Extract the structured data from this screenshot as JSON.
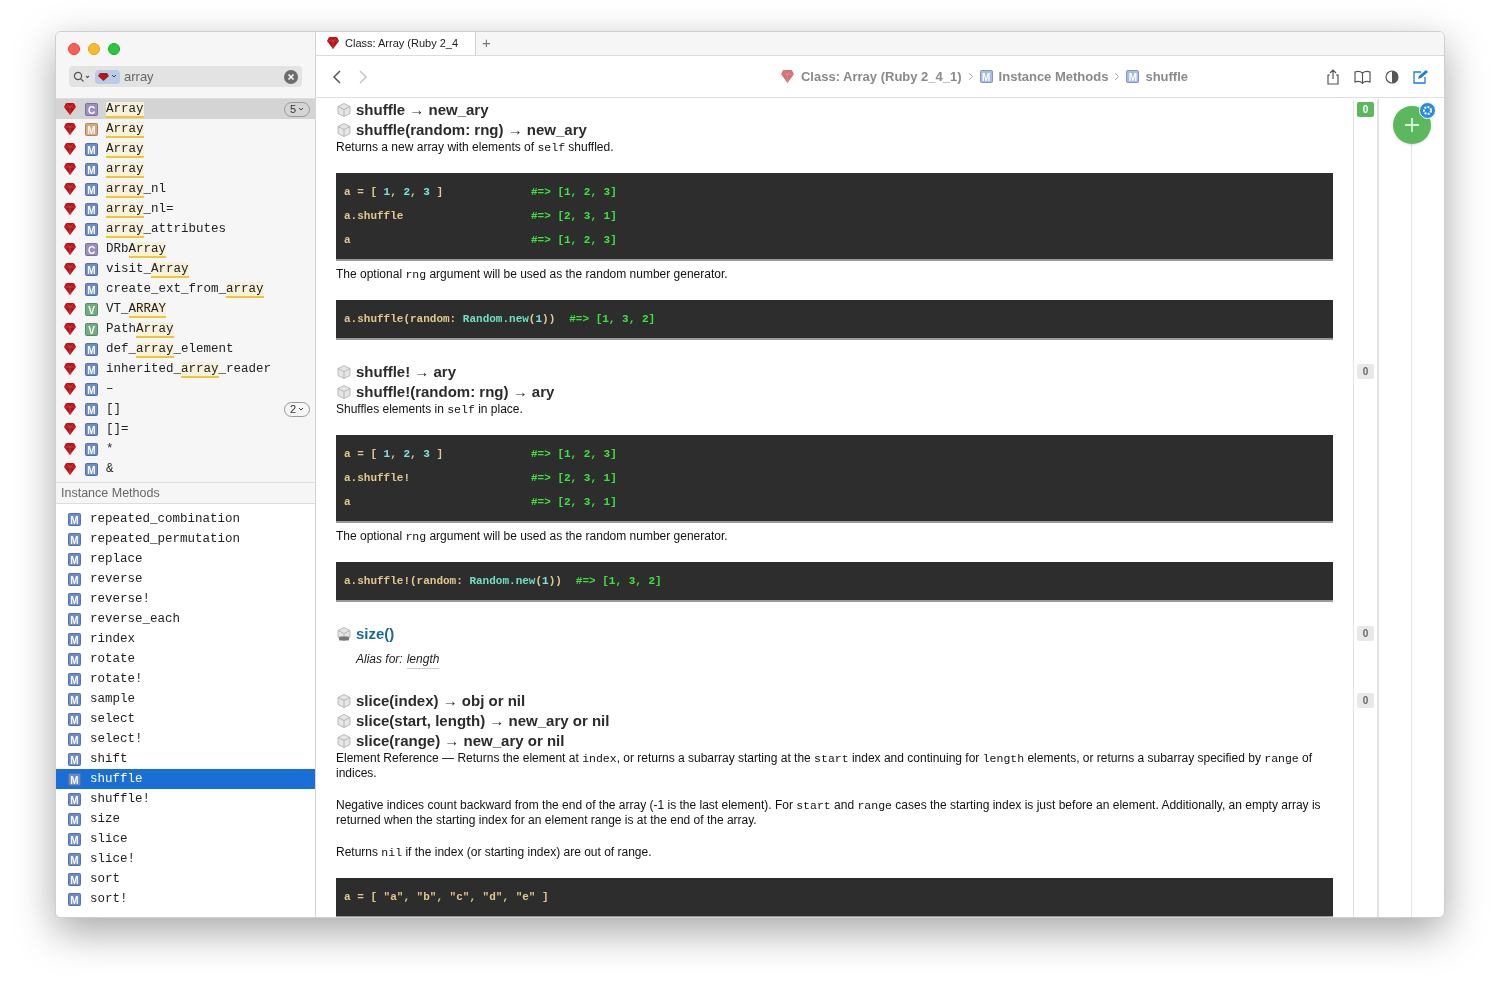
{
  "search": {
    "value": "array"
  },
  "results": [
    {
      "letter": "C",
      "color": "#9d8fc4",
      "match": "Array",
      "selected": true,
      "count": "5"
    },
    {
      "letter": "M",
      "color": "#dba77c",
      "match": "Array",
      "selected": false
    },
    {
      "letter": "M",
      "color": "#6a8ccf",
      "match": "Array",
      "selected": false
    },
    {
      "letter": "M",
      "color": "#6a8ccf",
      "match": "array",
      "selected": false
    },
    {
      "letter": "M",
      "color": "#6a8ccf",
      "match": "array",
      "post": "_nl",
      "selected": false
    },
    {
      "letter": "M",
      "color": "#6a8ccf",
      "match": "array",
      "post": "_nl=",
      "selected": false
    },
    {
      "letter": "M",
      "color": "#6a8ccf",
      "match": "array",
      "post": "_attributes",
      "selected": false
    },
    {
      "letter": "C",
      "color": "#9d8fc4",
      "pre": "DRb",
      "match": "Array",
      "selected": false
    },
    {
      "letter": "M",
      "color": "#6a8ccf",
      "pre": "visit_",
      "match": "Array",
      "selected": false
    },
    {
      "letter": "M",
      "color": "#6a8ccf",
      "pre": "create_ext_from_",
      "match": "array",
      "selected": false
    },
    {
      "letter": "V",
      "color": "#6fae7f",
      "pre": "VT_",
      "match": "ARRAY",
      "selected": false
    },
    {
      "letter": "V",
      "color": "#6fae7f",
      "pre": "Path",
      "match": "Array",
      "selected": false
    },
    {
      "letter": "M",
      "color": "#6a8ccf",
      "pre": "def_",
      "match": "array",
      "post": "_element",
      "selected": false
    },
    {
      "letter": "M",
      "color": "#6a8ccf",
      "pre": "inherited_",
      "match": "array",
      "post": "_reader",
      "selected": false
    },
    {
      "letter": "M",
      "color": "#6a8ccf",
      "pre": "–",
      "selected": false
    },
    {
      "letter": "M",
      "color": "#6a8ccf",
      "pre": "[]",
      "selected": false,
      "count": "2"
    },
    {
      "letter": "M",
      "color": "#6a8ccf",
      "pre": "[]=",
      "selected": false
    },
    {
      "letter": "M",
      "color": "#6a8ccf",
      "pre": "*",
      "selected": false
    },
    {
      "letter": "M",
      "color": "#6a8ccf",
      "pre": "&",
      "selected": false
    }
  ],
  "section_header": "Instance Methods",
  "methods": [
    {
      "letter": "M",
      "name": "repeated_combination",
      "selected": false
    },
    {
      "letter": "M",
      "name": "repeated_permutation",
      "selected": false
    },
    {
      "letter": "M",
      "name": "replace",
      "selected": false
    },
    {
      "letter": "M",
      "name": "reverse",
      "selected": false
    },
    {
      "letter": "M",
      "name": "reverse!",
      "selected": false
    },
    {
      "letter": "M",
      "name": "reverse_each",
      "selected": false
    },
    {
      "letter": "M",
      "name": "rindex",
      "selected": false
    },
    {
      "letter": "M",
      "name": "rotate",
      "selected": false
    },
    {
      "letter": "M",
      "name": "rotate!",
      "selected": false
    },
    {
      "letter": "M",
      "name": "sample",
      "selected": false
    },
    {
      "letter": "M",
      "name": "select",
      "selected": false
    },
    {
      "letter": "M",
      "name": "select!",
      "selected": false
    },
    {
      "letter": "M",
      "name": "shift",
      "selected": false
    },
    {
      "letter": "M",
      "name": "shuffle",
      "selected": true
    },
    {
      "letter": "M",
      "name": "shuffle!",
      "selected": false
    },
    {
      "letter": "M",
      "name": "size",
      "selected": false
    },
    {
      "letter": "M",
      "name": "slice",
      "selected": false
    },
    {
      "letter": "M",
      "name": "slice!",
      "selected": false
    },
    {
      "letter": "M",
      "name": "sort",
      "selected": false
    },
    {
      "letter": "M",
      "name": "sort!",
      "selected": false
    }
  ],
  "tabs": [
    {
      "label": "Class: Array (Ruby 2_4",
      "selected": true
    }
  ],
  "new_tab": "+",
  "breadcrumb": [
    {
      "kind": "docset",
      "text": "Class: Array (Ruby 2_4_1)"
    },
    {
      "kind": "entry",
      "letter": "M",
      "text": "Instance Methods"
    },
    {
      "kind": "entry",
      "letter": "M",
      "text": "shuffle"
    }
  ],
  "sections": [
    {
      "kind": "method",
      "badge": {
        "count": "0",
        "active": true
      },
      "signatures": [
        "shuffle → new_ary",
        "shuffle(random: rng) → new_ary"
      ],
      "body": [
        {
          "kind": "para",
          "segments": [
            {
              "kind": "text",
              "text": "Returns a new array with elements of "
            },
            {
              "kind": "code",
              "text": "self"
            },
            {
              "kind": "text",
              "text": " shuffled."
            }
          ]
        },
        {
          "kind": "code",
          "lines": [
            {
              "code": [
                {
                  "kind": "plain",
                  "text": "a = [ "
                },
                {
                  "kind": "number",
                  "text": "1"
                },
                {
                  "kind": "plain",
                  "text": ", "
                },
                {
                  "kind": "number",
                  "text": "2"
                },
                {
                  "kind": "plain",
                  "text": ", "
                },
                {
                  "kind": "number",
                  "text": "3"
                },
                {
                  "kind": "plain",
                  "text": " ]"
                }
              ],
              "result": "#=> [1, 2, 3]"
            },
            {
              "code": [
                {
                  "kind": "plain",
                  "text": "a.shuffle"
                }
              ],
              "result": "#=> [2, 3, 1]"
            },
            {
              "code": [
                {
                  "kind": "plain",
                  "text": "a"
                }
              ],
              "result": "#=> [1, 2, 3]"
            }
          ]
        },
        {
          "kind": "para",
          "segments": [
            {
              "kind": "text",
              "text": "The optional "
            },
            {
              "kind": "code",
              "text": "rng"
            },
            {
              "kind": "text",
              "text": " argument will be used as the random number generator."
            }
          ]
        },
        {
          "kind": "code",
          "lines": [
            {
              "code": [
                {
                  "kind": "plain",
                  "text": "a.shuffle(random: "
                },
                {
                  "kind": "constant",
                  "text": "Random.new"
                },
                {
                  "kind": "plain",
                  "text": "("
                },
                {
                  "kind": "number",
                  "text": "1"
                },
                {
                  "kind": "plain",
                  "text": "))"
                }
              ],
              "result": "#=> [1, 3, 2]"
            }
          ]
        }
      ]
    },
    {
      "kind": "method",
      "badge": {
        "count": "0",
        "active": false
      },
      "signatures": [
        "shuffle! → ary",
        "shuffle!(random: rng) → ary"
      ],
      "body": [
        {
          "kind": "para",
          "segments": [
            {
              "kind": "text",
              "text": "Shuffles elements in "
            },
            {
              "kind": "code",
              "text": "self"
            },
            {
              "kind": "text",
              "text": " in place."
            }
          ]
        },
        {
          "kind": "code",
          "lines": [
            {
              "code": [
                {
                  "kind": "plain",
                  "text": "a = [ "
                },
                {
                  "kind": "number",
                  "text": "1"
                },
                {
                  "kind": "plain",
                  "text": ", "
                },
                {
                  "kind": "number",
                  "text": "2"
                },
                {
                  "kind": "plain",
                  "text": ", "
                },
                {
                  "kind": "number",
                  "text": "3"
                },
                {
                  "kind": "plain",
                  "text": " ]"
                }
              ],
              "result": "#=> [1, 2, 3]"
            },
            {
              "code": [
                {
                  "kind": "plain",
                  "text": "a.shuffle!"
                }
              ],
              "result": "#=> [2, 3, 1]"
            },
            {
              "code": [
                {
                  "kind": "plain",
                  "text": "a"
                }
              ],
              "result": "#=> [2, 3, 1]"
            }
          ]
        },
        {
          "kind": "para",
          "segments": [
            {
              "kind": "text",
              "text": "The optional "
            },
            {
              "kind": "code",
              "text": "rng"
            },
            {
              "kind": "text",
              "text": " argument will be used as the random number generator."
            }
          ]
        },
        {
          "kind": "code",
          "lines": [
            {
              "code": [
                {
                  "kind": "plain",
                  "text": "a.shuffle!(random: "
                },
                {
                  "kind": "constant",
                  "text": "Random.new"
                },
                {
                  "kind": "plain",
                  "text": "("
                },
                {
                  "kind": "number",
                  "text": "1"
                },
                {
                  "kind": "plain",
                  "text": "))"
                }
              ],
              "result": "#=> [1, 3, 2]"
            }
          ]
        }
      ]
    },
    {
      "kind": "alias",
      "badge": {
        "count": "0",
        "active": false
      },
      "signatures": [
        "size()"
      ],
      "alias_label": "Alias for:",
      "alias_target": "length"
    },
    {
      "kind": "method",
      "badge": {
        "count": "0",
        "active": false
      },
      "signatures": [
        "slice(index) → obj or nil",
        "slice(start, length) → new_ary or nil",
        "slice(range) → new_ary or nil"
      ],
      "body": [
        {
          "kind": "para",
          "segments": [
            {
              "kind": "text",
              "text": "Element Reference — Returns the element at "
            },
            {
              "kind": "code",
              "text": "index"
            },
            {
              "kind": "text",
              "text": ", or returns a subarray starting at the "
            },
            {
              "kind": "code",
              "text": "start"
            },
            {
              "kind": "text",
              "text": " index and continuing for "
            },
            {
              "kind": "code",
              "text": "length"
            },
            {
              "kind": "text",
              "text": " elements, or returns a subarray specified by "
            },
            {
              "kind": "code",
              "text": "range"
            },
            {
              "kind": "text",
              "text": " of indices."
            }
          ]
        },
        {
          "kind": "para",
          "segments": [
            {
              "kind": "text",
              "text": "Negative indices count backward from the end of the array (-1 is the last element). For "
            },
            {
              "kind": "code",
              "text": "start"
            },
            {
              "kind": "text",
              "text": " and "
            },
            {
              "kind": "code",
              "text": "range"
            },
            {
              "kind": "text",
              "text": " cases the starting index is just before an element. Additionally, an empty array is returned when the starting index for an element range is at the end of the array."
            }
          ]
        },
        {
          "kind": "para",
          "segments": [
            {
              "kind": "text",
              "text": "Returns "
            },
            {
              "kind": "code",
              "text": "nil"
            },
            {
              "kind": "text",
              "text": " if the index (or starting index) are out of range."
            }
          ]
        },
        {
          "kind": "code",
          "lines": [
            {
              "code": [
                {
                  "kind": "plain",
                  "text": "a = [ \"a\", \"b\", \"c\", \"d\", \"e\" ]"
                }
              ]
            }
          ]
        }
      ]
    }
  ]
}
